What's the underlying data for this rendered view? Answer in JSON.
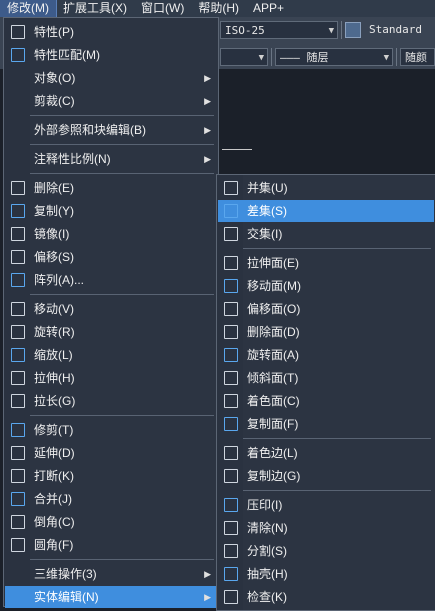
{
  "menubar": [
    {
      "label": "修改(M)",
      "active": true
    },
    {
      "label": "扩展工具(X)",
      "active": false
    },
    {
      "label": "窗口(W)",
      "active": false
    },
    {
      "label": "帮助(H)",
      "active": false
    },
    {
      "label": "APP+",
      "active": false
    }
  ],
  "toolbar": {
    "dimstyle": "ISO-25",
    "textstyle": "Standard",
    "linetype": "——— 随层",
    "lineweight": "随颜"
  },
  "main_menu": [
    {
      "label": "特性(P)",
      "icon": "properties-icon",
      "sep_before": false,
      "submenu": false
    },
    {
      "label": "特性匹配(M)",
      "icon": "match-properties-icon",
      "sep_before": false,
      "submenu": false
    },
    {
      "label": "对象(O)",
      "icon": "",
      "sep_before": false,
      "submenu": true
    },
    {
      "label": "剪裁(C)",
      "icon": "",
      "sep_before": false,
      "submenu": true
    },
    {
      "label": "外部参照和块编辑(B)",
      "icon": "",
      "sep_before": true,
      "submenu": true
    },
    {
      "label": "注释性比例(N)",
      "icon": "",
      "sep_before": true,
      "submenu": true
    },
    {
      "label": "删除(E)",
      "icon": "erase-icon",
      "sep_before": true,
      "submenu": false
    },
    {
      "label": "复制(Y)",
      "icon": "copy-icon",
      "sep_before": false,
      "submenu": false
    },
    {
      "label": "镜像(I)",
      "icon": "mirror-icon",
      "sep_before": false,
      "submenu": false
    },
    {
      "label": "偏移(S)",
      "icon": "offset-icon",
      "sep_before": false,
      "submenu": false
    },
    {
      "label": "阵列(A)...",
      "icon": "array-icon",
      "sep_before": false,
      "submenu": false
    },
    {
      "label": "移动(V)",
      "icon": "move-icon",
      "sep_before": true,
      "submenu": false
    },
    {
      "label": "旋转(R)",
      "icon": "rotate-icon",
      "sep_before": false,
      "submenu": false
    },
    {
      "label": "缩放(L)",
      "icon": "scale-icon",
      "sep_before": false,
      "submenu": false
    },
    {
      "label": "拉伸(H)",
      "icon": "stretch-icon",
      "sep_before": false,
      "submenu": false
    },
    {
      "label": "拉长(G)",
      "icon": "lengthen-icon",
      "sep_before": false,
      "submenu": false
    },
    {
      "label": "修剪(T)",
      "icon": "trim-icon",
      "sep_before": true,
      "submenu": false
    },
    {
      "label": "延伸(D)",
      "icon": "extend-icon",
      "sep_before": false,
      "submenu": false
    },
    {
      "label": "打断(K)",
      "icon": "break-icon",
      "sep_before": false,
      "submenu": false
    },
    {
      "label": "合并(J)",
      "icon": "join-icon",
      "sep_before": false,
      "submenu": false
    },
    {
      "label": "倒角(C)",
      "icon": "chamfer-icon",
      "sep_before": false,
      "submenu": false
    },
    {
      "label": "圆角(F)",
      "icon": "fillet-icon",
      "sep_before": false,
      "submenu": false
    },
    {
      "label": "三维操作(3)",
      "icon": "",
      "sep_before": true,
      "submenu": true
    },
    {
      "label": "实体编辑(N)",
      "icon": "",
      "sep_before": false,
      "submenu": true,
      "highlighted": true
    }
  ],
  "sub_menu": [
    {
      "label": "并集(U)",
      "icon": "union-icon",
      "sep_before": false
    },
    {
      "label": "差集(S)",
      "icon": "subtract-icon",
      "sep_before": false,
      "highlighted": true
    },
    {
      "label": "交集(I)",
      "icon": "intersect-icon",
      "sep_before": false
    },
    {
      "label": "拉伸面(E)",
      "icon": "extrude-face-icon",
      "sep_before": true
    },
    {
      "label": "移动面(M)",
      "icon": "move-face-icon",
      "sep_before": false
    },
    {
      "label": "偏移面(O)",
      "icon": "offset-face-icon",
      "sep_before": false
    },
    {
      "label": "删除面(D)",
      "icon": "delete-face-icon",
      "sep_before": false
    },
    {
      "label": "旋转面(A)",
      "icon": "rotate-face-icon",
      "sep_before": false
    },
    {
      "label": "倾斜面(T)",
      "icon": "taper-face-icon",
      "sep_before": false
    },
    {
      "label": "着色面(C)",
      "icon": "color-face-icon",
      "sep_before": false
    },
    {
      "label": "复制面(F)",
      "icon": "copy-face-icon",
      "sep_before": false
    },
    {
      "label": "着色边(L)",
      "icon": "color-edge-icon",
      "sep_before": true
    },
    {
      "label": "复制边(G)",
      "icon": "copy-edge-icon",
      "sep_before": false
    },
    {
      "label": "压印(I)",
      "icon": "imprint-icon",
      "sep_before": true
    },
    {
      "label": "清除(N)",
      "icon": "clean-icon",
      "sep_before": false
    },
    {
      "label": "分割(S)",
      "icon": "separate-icon",
      "sep_before": false
    },
    {
      "label": "抽壳(H)",
      "icon": "shell-icon",
      "sep_before": false
    },
    {
      "label": "检查(K)",
      "icon": "check-icon",
      "sep_before": false
    }
  ],
  "colors": {
    "highlight": "#3f8ede",
    "menu_bg": "#2c3442",
    "canvas": "#1b2029"
  }
}
